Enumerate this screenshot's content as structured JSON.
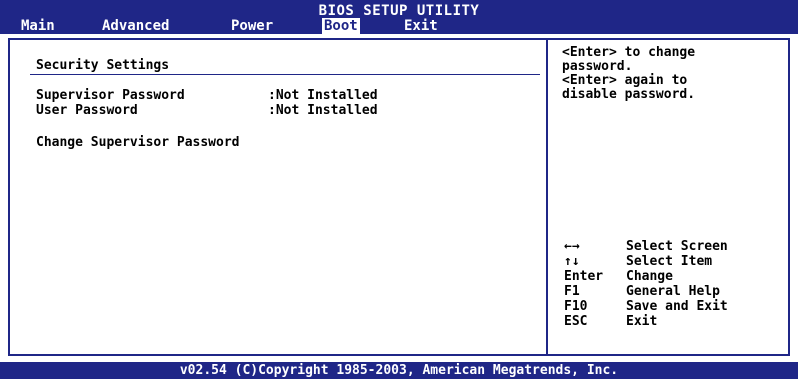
{
  "header": {
    "title": "BIOS SETUP UTILITY",
    "menu": [
      {
        "label": "Main",
        "active": false
      },
      {
        "label": "Advanced",
        "active": false
      },
      {
        "label": "Power",
        "active": false
      },
      {
        "label": "Boot",
        "active": true
      },
      {
        "label": "Exit",
        "active": false
      }
    ]
  },
  "main": {
    "section_title": "Security Settings",
    "rows": [
      {
        "label": "Supervisor Password",
        "value": ":Not Installed"
      },
      {
        "label": "User Password",
        "value": ":Not Installed"
      }
    ],
    "change_item": "Change Supervisor Password"
  },
  "help": {
    "text": "<Enter> to change\npassword.\n<Enter> again to\ndisable password.",
    "keys": [
      {
        "key": "←→",
        "desc": "Select Screen"
      },
      {
        "key": "↑↓",
        "desc": "Select Item"
      },
      {
        "key": "Enter",
        "desc": "Change"
      },
      {
        "key": "F1",
        "desc": "General Help"
      },
      {
        "key": "F10",
        "desc": "Save and Exit"
      },
      {
        "key": "ESC",
        "desc": "Exit"
      }
    ]
  },
  "footer": {
    "text": "v02.54 (C)Copyright 1985-2003, American Megatrends, Inc."
  },
  "colors": {
    "bar": "#1f2687",
    "background": "#ffffff",
    "text": "#000000"
  }
}
